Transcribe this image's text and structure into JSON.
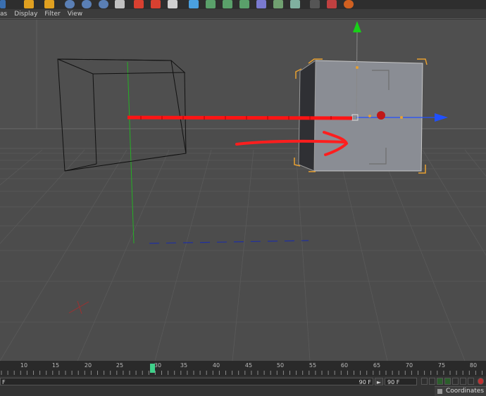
{
  "menu": {
    "items": [
      "as",
      "Display",
      "Filter",
      "View"
    ]
  },
  "toolbar": {
    "icons": [
      "render-icon",
      "loop-icon",
      "add-icon",
      "x-axis-icon",
      "y-axis-icon",
      "z-axis-icon",
      "coordinate-icon",
      "render-view-icon",
      "render-settings-icon",
      "render-picture-viewer-icon",
      "cube-icon",
      "spline-icon",
      "nurbs-icon",
      "array-icon",
      "deformer-icon",
      "scene-icon",
      "light-icon",
      "camera-icon",
      "tag-icon",
      "globe-icon"
    ]
  },
  "timeline": {
    "ticks": [
      "10",
      "15",
      "20",
      "25",
      "30",
      "35",
      "40",
      "45",
      "50",
      "55",
      "60",
      "65",
      "70",
      "75",
      "80"
    ],
    "current_frame": 30,
    "start_field": "F",
    "end_field": "90 F",
    "max_field": "90 F"
  },
  "panel": {
    "coordinates_tab": "Coordinates"
  },
  "colors": {
    "viewport_bg": "#4c4c4c",
    "selection": "#e8a030",
    "x_axis": "#ff2020",
    "y_axis": "#18d018",
    "z_axis": "#2050ff"
  }
}
